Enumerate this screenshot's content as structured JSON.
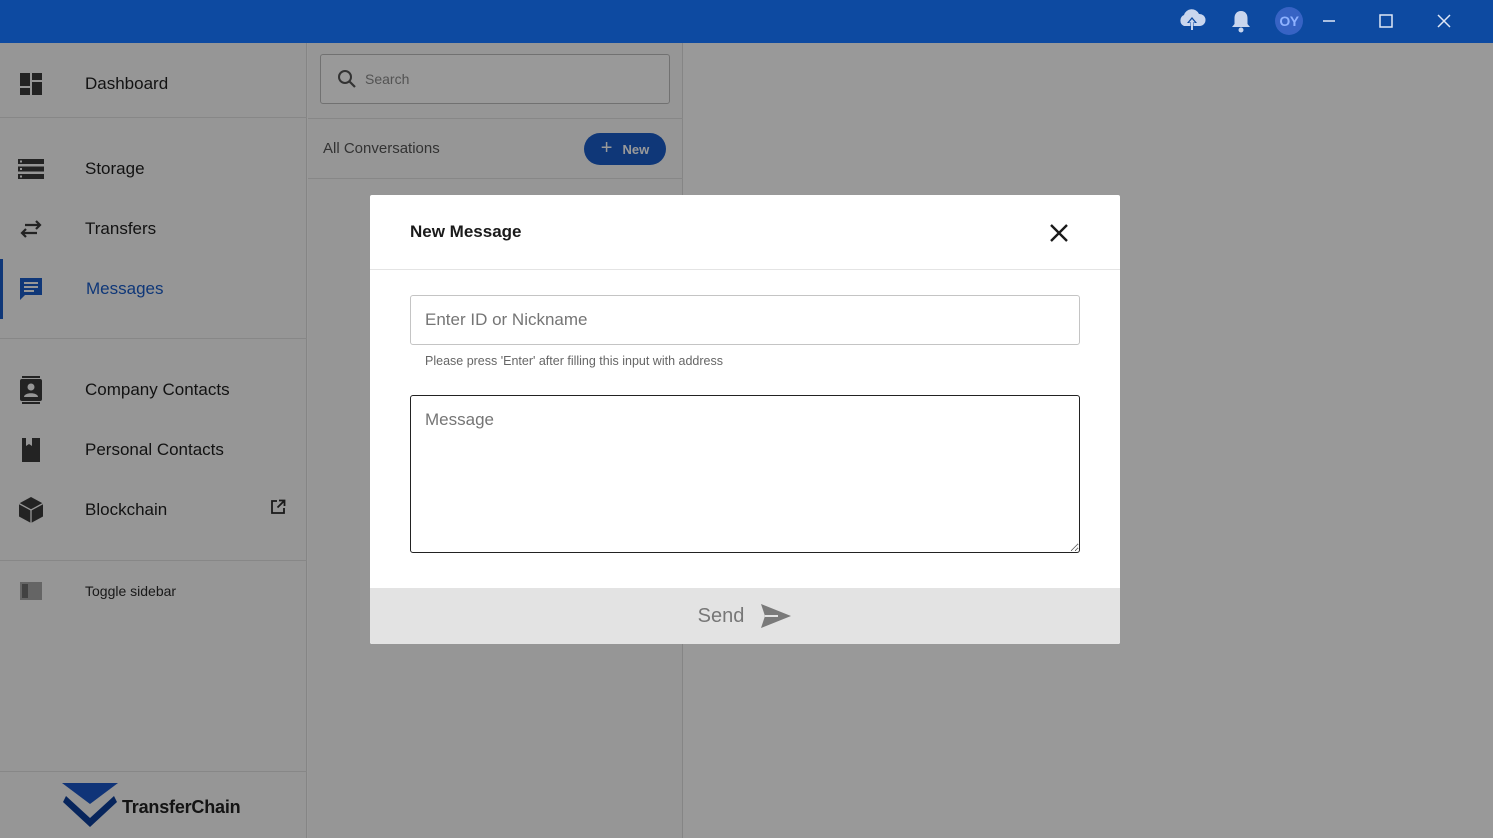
{
  "titlebar": {
    "avatar_initials": "OY",
    "accent_color": "#0d4aa1"
  },
  "sidebar": {
    "items": [
      {
        "label": "Dashboard",
        "icon": "dashboard-icon"
      },
      {
        "label": "Storage",
        "icon": "storage-icon"
      },
      {
        "label": "Transfers",
        "icon": "transfers-icon"
      },
      {
        "label": "Messages",
        "icon": "messages-icon",
        "active": true
      },
      {
        "label": "Company Contacts",
        "icon": "company-contacts-icon"
      },
      {
        "label": "Personal Contacts",
        "icon": "personal-contacts-icon"
      },
      {
        "label": "Blockchain",
        "icon": "blockchain-icon",
        "external": true
      }
    ],
    "toggle_label": "Toggle sidebar",
    "brand": "TransferChain",
    "active_color": "#1a5dc9"
  },
  "conversations": {
    "search_placeholder": "Search",
    "header_label": "All Conversations",
    "new_button_label": "New"
  },
  "modal": {
    "title": "New Message",
    "id_placeholder": "Enter ID or Nickname",
    "hint": "Please press 'Enter' after filling this input with address",
    "message_placeholder": "Message",
    "send_label": "Send"
  }
}
